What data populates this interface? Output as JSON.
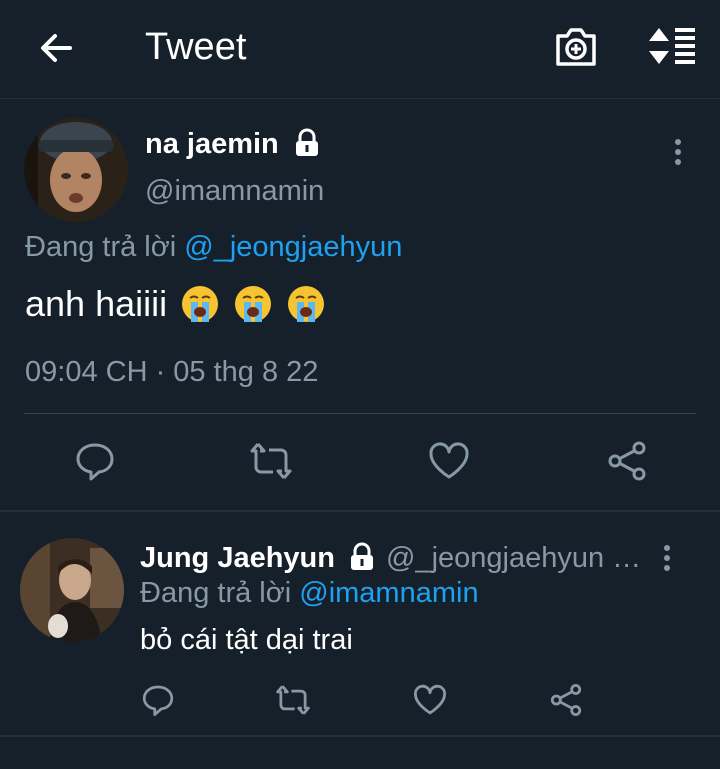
{
  "header": {
    "title": "Tweet",
    "back_icon": "arrow-left-icon",
    "camera_icon": "camera-icon",
    "sort_icon": "sort-icon"
  },
  "tweet": {
    "author_name": "na jaemin",
    "handle": "@imamnamin",
    "reply_prefix": "Đang trả lời",
    "reply_to": "@_jeongjaehyun",
    "text": "anh haiiii",
    "emoji": "😭😭😭",
    "timestamp": "09:04 CH · 05 thg 8 22"
  },
  "reply": {
    "author_name": "Jung Jaehyun",
    "handle": "@_jeongjaehyun …",
    "reply_prefix": "Đang trả lời",
    "reply_to": "@imamnamin",
    "text": "bỏ cái tật dại trai"
  },
  "colors": {
    "background": "#15202b",
    "secondary_text": "#8899a6",
    "accent": "#1da1f2",
    "divider": "#38444d"
  }
}
